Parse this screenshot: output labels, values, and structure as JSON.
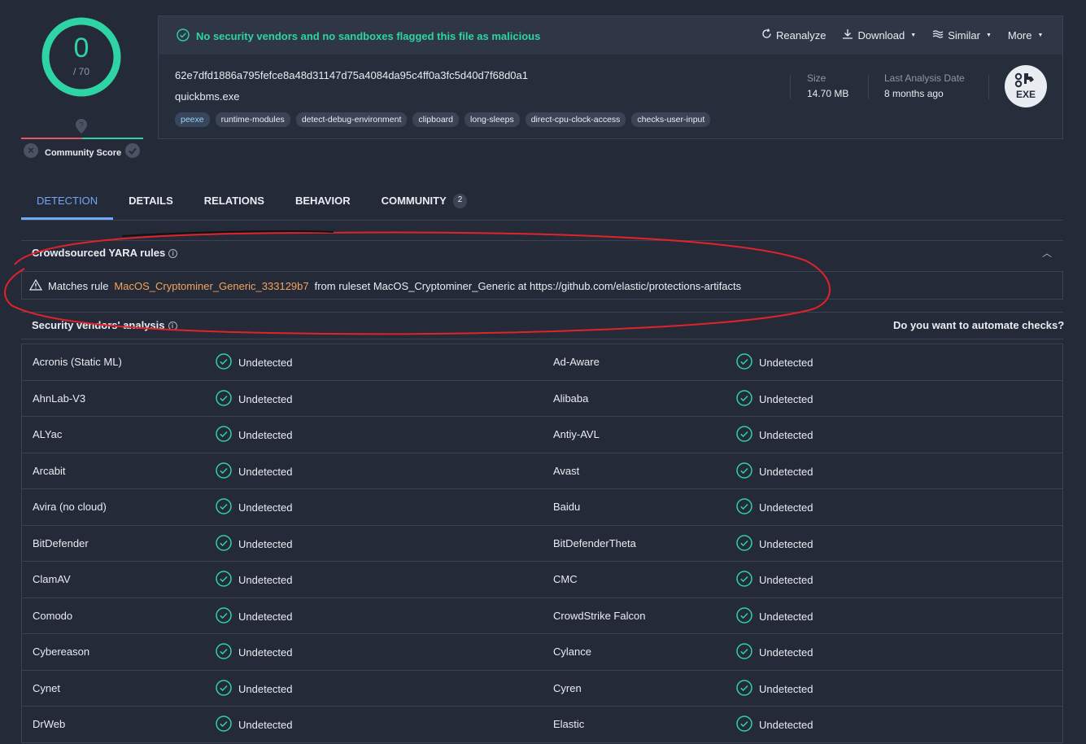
{
  "score": {
    "detections": "0",
    "total": "/ 70"
  },
  "community": {
    "label": "Community Score"
  },
  "verdict": "No security vendors and no sandboxes flagged this file as malicious",
  "actions": [
    {
      "label": "Reanalyze",
      "icon": "refresh-icon"
    },
    {
      "label": "Download",
      "icon": "download-icon"
    },
    {
      "label": "Similar",
      "icon": "similar-icon"
    },
    {
      "label": "More",
      "icon": ""
    }
  ],
  "file": {
    "hash": "62e7dfd1886a795fefce8a48d31147d75a4084da95c4ff0a3fc5d40d7f68d0a1",
    "name": "quickbms.exe",
    "tags": [
      "peexe",
      "runtime-modules",
      "detect-debug-environment",
      "clipboard",
      "long-sleeps",
      "direct-cpu-clock-access",
      "checks-user-input"
    ],
    "size_label": "Size",
    "size_value": "14.70 MB",
    "date_label": "Last Analysis Date",
    "date_value": "8 months ago",
    "type_badge": "EXE"
  },
  "tabs": [
    {
      "label": "DETECTION",
      "active": true
    },
    {
      "label": "DETAILS"
    },
    {
      "label": "RELATIONS"
    },
    {
      "label": "BEHAVIOR"
    },
    {
      "label": "COMMUNITY",
      "badge": "2"
    }
  ],
  "yara": {
    "title": "Crowdsourced YARA rules",
    "prefix": "Matches rule",
    "rule": "MacOS_Cryptominer_Generic_333129b7",
    "suffix": "from ruleset MacOS_Cryptominer_Generic at https://github.com/elastic/protections-artifacts"
  },
  "vendors": {
    "title": "Security vendors' analysis",
    "automate": "Do you want to automate checks?",
    "rows": [
      {
        "left": "Acronis (Static ML)",
        "left_result": "Undetected",
        "right": "Ad-Aware",
        "right_result": "Undetected"
      },
      {
        "left": "AhnLab-V3",
        "left_result": "Undetected",
        "right": "Alibaba",
        "right_result": "Undetected"
      },
      {
        "left": "ALYac",
        "left_result": "Undetected",
        "right": "Antiy-AVL",
        "right_result": "Undetected"
      },
      {
        "left": "Arcabit",
        "left_result": "Undetected",
        "right": "Avast",
        "right_result": "Undetected"
      },
      {
        "left": "Avira (no cloud)",
        "left_result": "Undetected",
        "right": "Baidu",
        "right_result": "Undetected"
      },
      {
        "left": "BitDefender",
        "left_result": "Undetected",
        "right": "BitDefenderTheta",
        "right_result": "Undetected"
      },
      {
        "left": "ClamAV",
        "left_result": "Undetected",
        "right": "CMC",
        "right_result": "Undetected"
      },
      {
        "left": "Comodo",
        "left_result": "Undetected",
        "right": "CrowdStrike Falcon",
        "right_result": "Undetected"
      },
      {
        "left": "Cybereason",
        "left_result": "Undetected",
        "right": "Cylance",
        "right_result": "Undetected"
      },
      {
        "left": "Cynet",
        "left_result": "Undetected",
        "right": "Cyren",
        "right_result": "Undetected"
      },
      {
        "left": "DrWeb",
        "left_result": "Undetected",
        "right": "Elastic",
        "right_result": "Undetected"
      }
    ]
  },
  "colors": {
    "accent": "#2ed4a4",
    "link": "#6fa9f5",
    "rule": "#f4a35d",
    "annotation": "#e0232b"
  }
}
